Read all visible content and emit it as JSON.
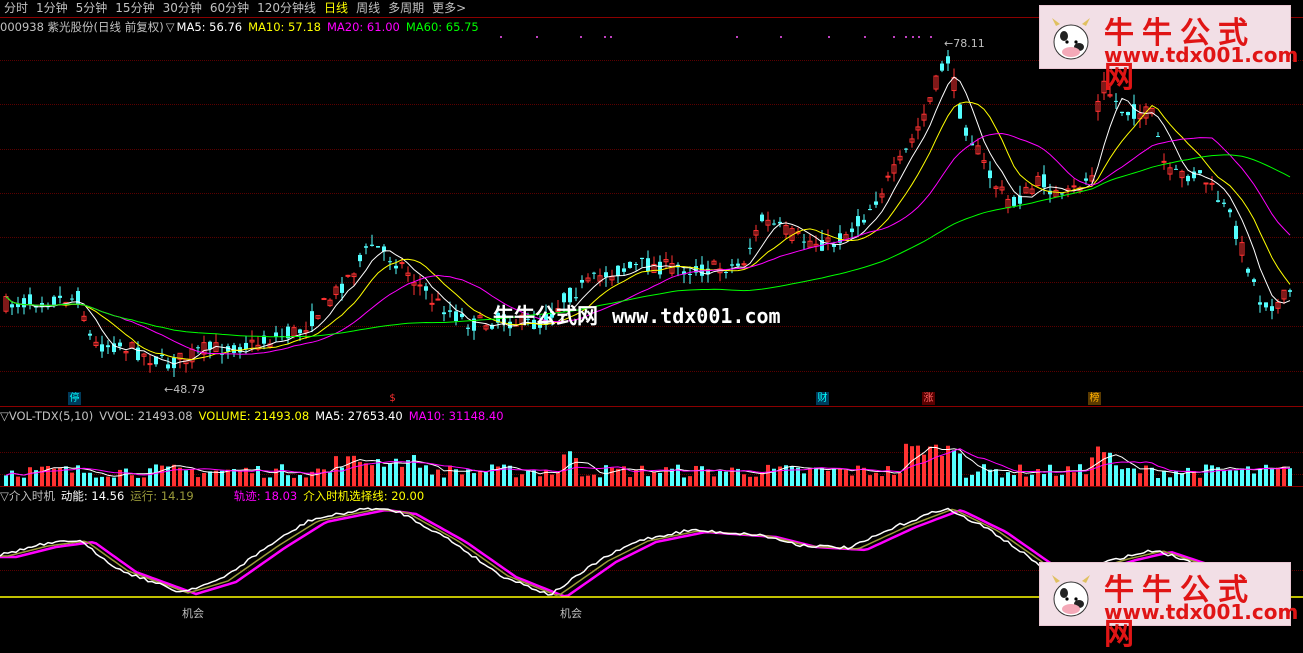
{
  "toolbar": {
    "tabs": [
      {
        "label": "分时",
        "active": false
      },
      {
        "label": "1分钟",
        "active": false
      },
      {
        "label": "5分钟",
        "active": false
      },
      {
        "label": "15分钟",
        "active": false
      },
      {
        "label": "30分钟",
        "active": false
      },
      {
        "label": "60分钟",
        "active": false
      },
      {
        "label": "120分钟线",
        "active": false
      },
      {
        "label": "日线",
        "active": true
      },
      {
        "label": "周线",
        "active": false
      },
      {
        "label": "多周期",
        "active": false
      },
      {
        "label": "更多>",
        "active": false
      }
    ]
  },
  "price_panel": {
    "stock_title": "000938 紫光股份(日线 前复权)",
    "ma_marker": "▽",
    "ma5": "MA5: 56.76",
    "ma10": "MA10: 57.18",
    "ma20": "MA20: 61.00",
    "ma60": "MA60: 65.75",
    "high_label": "78.11",
    "low_label": "48.79",
    "event_badges": [
      {
        "label": "停",
        "color": "#00ffff"
      },
      {
        "label": "$",
        "color": "#ff3030"
      },
      {
        "label": "财",
        "color": "#00ffff"
      },
      {
        "label": "涨",
        "color": "#ff6060"
      },
      {
        "label": "榜",
        "color": "#ffb000"
      }
    ]
  },
  "volume_panel": {
    "title": "▽VOL-TDX(5,10)",
    "vvol": "VVOL: 21493.08",
    "volume": "VOLUME: 21493.08",
    "ma5": "MA5: 27653.40",
    "ma10": "MA10: 31148.40"
  },
  "indicator_panel": {
    "title": "▽介入时机",
    "dongneng": "动能: 14.56",
    "yunxing": "运行: 14.19",
    "guiji": "轨迹: 18.03",
    "xuanze": "介入时机选择线: 20.00",
    "opportunity_labels": [
      "机会",
      "机会"
    ]
  },
  "watermark": {
    "title": "牛牛公式网",
    "url": "www.tdx001.com",
    "center_cn": "牛牛公式网",
    "center_url": "www.tdx001.com"
  },
  "colors": {
    "up": "#ff3232",
    "down": "#54ffff",
    "ma5": "#ffffff",
    "ma10": "#ffff00",
    "ma20": "#ff00ff",
    "ma60": "#00ff00",
    "accent": "#e01515"
  }
}
